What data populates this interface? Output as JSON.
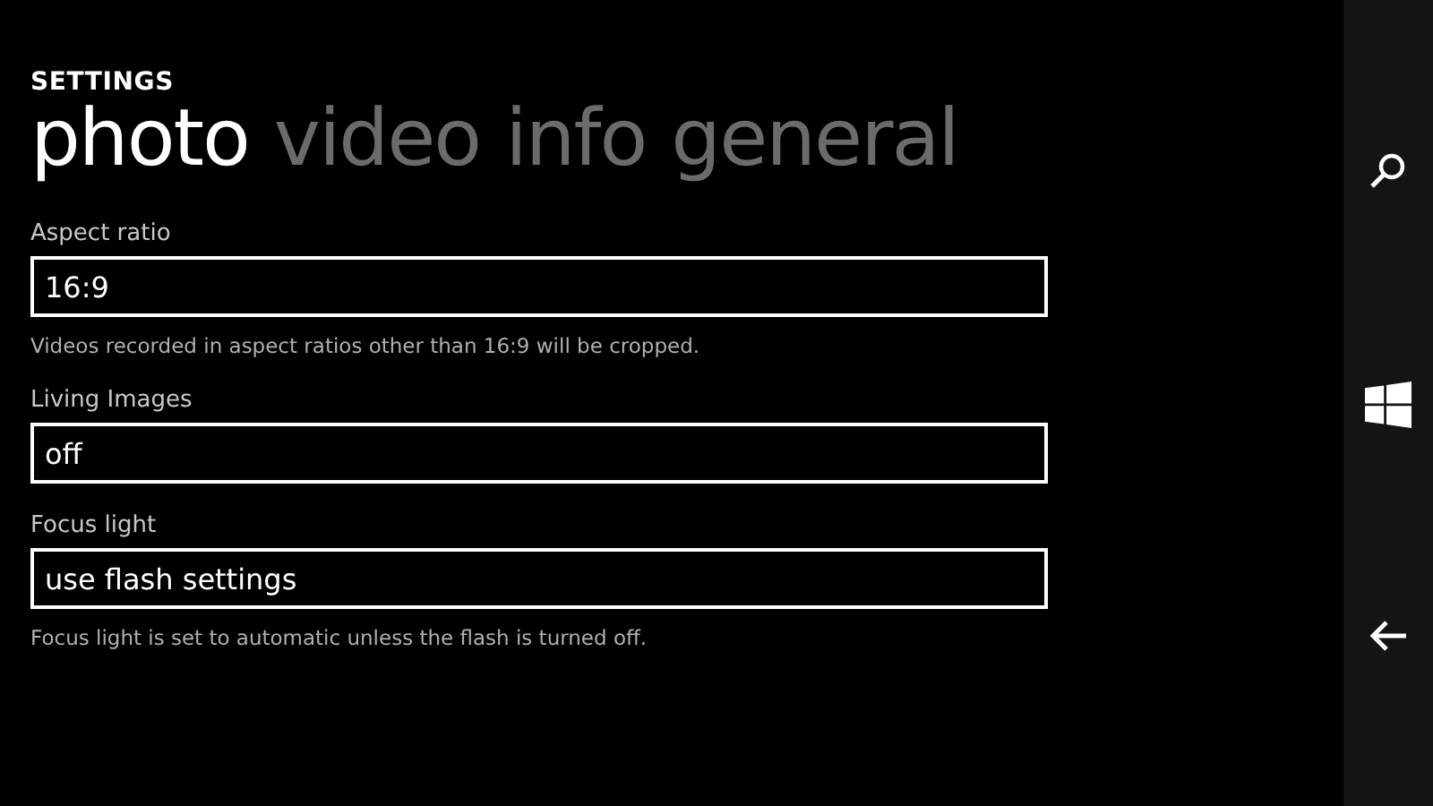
{
  "title": "SETTINGS",
  "tabs": [
    {
      "label": "photo",
      "selected": true
    },
    {
      "label": "video",
      "selected": false
    },
    {
      "label": "info",
      "selected": false
    },
    {
      "label": "general",
      "selected": false
    }
  ],
  "settings": [
    {
      "label": "Aspect ratio",
      "value": "16:9",
      "note": "Videos recorded in aspect ratios other than 16:9 will be cropped."
    },
    {
      "label": "Living Images",
      "value": "off"
    },
    {
      "label": "Focus light",
      "value": "use flash settings",
      "note": "Focus light is set to automatic unless the flash is turned off."
    }
  ]
}
